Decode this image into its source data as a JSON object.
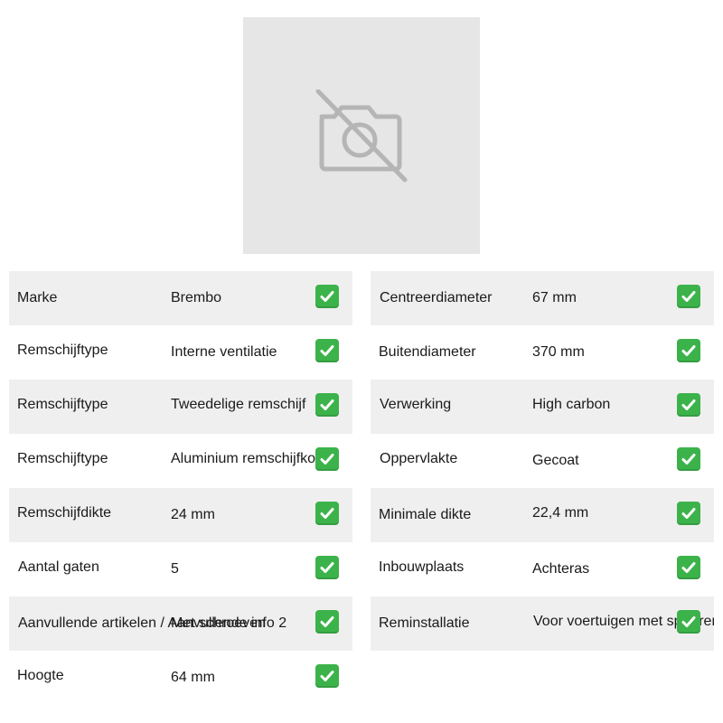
{
  "product": {
    "image_icon": "camera-off-icon"
  },
  "specs_left": [
    {
      "label": "Marke",
      "value": "Brembo",
      "status_icon": "check-icon"
    },
    {
      "label": "Remschijftype",
      "value": "Interne ventilatie",
      "status_icon": "check-icon"
    },
    {
      "label": "Remschijftype",
      "value": "Tweedelige remschijf",
      "status_icon": "check-icon"
    },
    {
      "label": "Remschijftype",
      "value": "Aluminium remschijfkom",
      "status_icon": "check-icon"
    },
    {
      "label": "Remschijfdikte",
      "value": "24 mm",
      "status_icon": "check-icon"
    },
    {
      "label": "Aantal gaten",
      "value": "5",
      "status_icon": "check-icon"
    },
    {
      "label": "Aanvullende artikelen / Aanvullende info 2",
      "value": "Met schroeven",
      "status_icon": "check-icon"
    },
    {
      "label": "Hoogte",
      "value": "64 mm",
      "status_icon": "check-icon"
    }
  ],
  "specs_right": [
    {
      "label": "Centreerdiameter",
      "value": "67 mm",
      "status_icon": "check-icon"
    },
    {
      "label": "Buitendiameter",
      "value": "370 mm",
      "status_icon": "check-icon"
    },
    {
      "label": "Verwerking",
      "value": "High carbon",
      "status_icon": "check-icon"
    },
    {
      "label": "Oppervlakte",
      "value": "Gecoat",
      "status_icon": "check-icon"
    },
    {
      "label": "Minimale dikte",
      "value": "22,4 mm",
      "status_icon": "check-icon"
    },
    {
      "label": "Inbouwplaats",
      "value": "Achteras",
      "status_icon": "check-icon"
    },
    {
      "label": "Reminstallatie",
      "value": "Voor voertuigen met sportremsysteem",
      "status_icon": "check-icon"
    }
  ],
  "colors": {
    "row_shaded": "#efefef",
    "image_placeholder": "#e6e6e6",
    "check_green": "#3cb34a"
  }
}
